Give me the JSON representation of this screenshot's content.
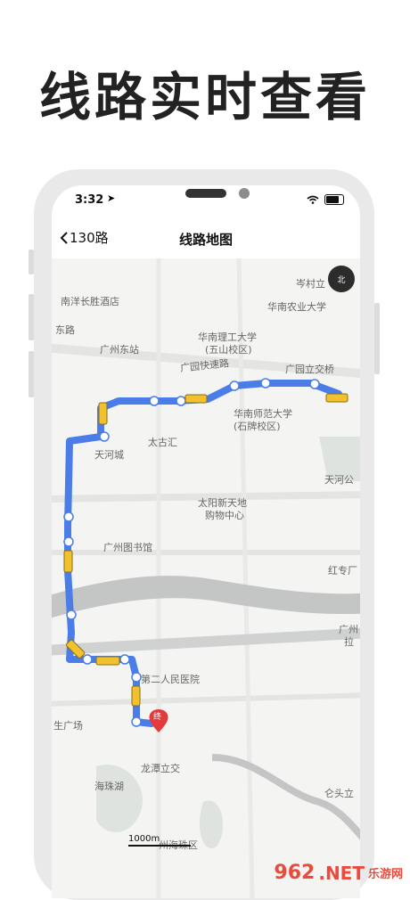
{
  "headline": "线路实时查看",
  "status_bar": {
    "time": "3:32"
  },
  "nav": {
    "back_label": "130路",
    "title": "线路地图"
  },
  "map": {
    "labels": [
      "岑村立",
      "南洋长胜酒店",
      "华南农业大学",
      "华南理工大学",
      "(五山校区)",
      "东路",
      "广州东站",
      "广园快速路",
      "广园立交桥",
      "华南师范大学",
      "(石牌校区)",
      "太古汇",
      "天河城",
      "天河公",
      "太阳新天地",
      "购物中心",
      "广州图书馆",
      "红专厂",
      "广州",
      "拉",
      "第二人民医院",
      "生广场",
      "龙潭立交",
      "海珠湖",
      "仑头立",
      "州海珠区"
    ],
    "end_marker": "终",
    "scale": "1000m",
    "compass_label": "北"
  },
  "watermark": {
    "logo": "962",
    "net": ".NET",
    "cn": "乐游网"
  },
  "colors": {
    "route": "#4a7de8",
    "bus": "#f2c12e",
    "end_marker": "#e33b3b"
  }
}
